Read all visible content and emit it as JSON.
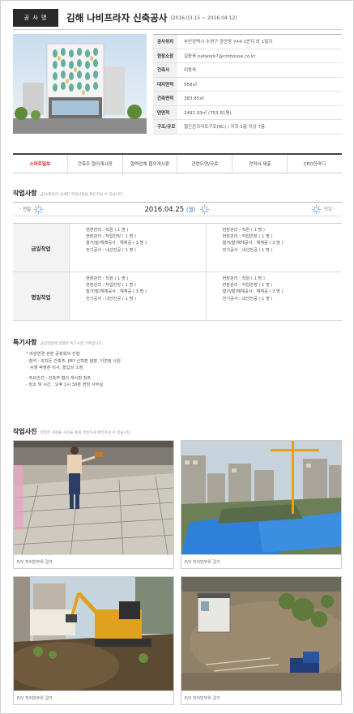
{
  "header": {
    "badge": "공 사 명",
    "title": "김해 나비프라자 신축공사",
    "dates": "(2016.03.15 ~ 2016.04.12)"
  },
  "info": [
    {
      "k": "공사위치",
      "v": "부산광역시 수영구 광안동 744-1번지 외 1필지"
    },
    {
      "k": "현장소장",
      "v": "김동욱 network7@cmhouse.co.kr"
    },
    {
      "k": "건축사",
      "v": "이동욱"
    },
    {
      "k": "대지면적",
      "v": "558㎡"
    },
    {
      "k": "건축면적",
      "v": "383.85㎡"
    },
    {
      "k": "연면적",
      "v": "2491.93㎡ (753.81평)"
    },
    {
      "k": "구조/규모",
      "v": "철근콘크리트구조(RC) / 지하 1층 지상 7층"
    }
  ],
  "tabs": [
    "스마트일보",
    "건축주 협의게시판",
    "협력업체 협의게시판",
    "관련도면/자료",
    "견적서 제출",
    "CEO한마디"
  ],
  "work": {
    "title": "작업사항",
    "desc": "금일/명일의 상세한 작업사항을 확인하실 수 있습니다.",
    "prev": "전일",
    "next": "명일",
    "date": "2016.04.25",
    "weekday": "(월)",
    "rows": [
      {
        "label": "금일작업",
        "cells": [
          [
            "현장관리 : 직원 ( 1 명 )",
            "현장관리 : 작업반장 ( 1 명 )",
            "철거/발/해체공사 : 해체공 ( 3 명 )",
            "전기공사 : 내선전공 ( 1 명 )"
          ],
          [
            "현장관리 : 직원 ( 1 명 )",
            "현장관리 : 작업반장 ( 1 명 )",
            "철거/발/해체공사 : 해체공 ( 3 명 )",
            "전기공사 : 내선전공 ( 1 명 )"
          ]
        ]
      },
      {
        "label": "명일작업",
        "cells": [
          [
            "현장관리 : 직원 ( 1 명 )",
            "현장관리 : 작업반장 ( 1 명 )",
            "철거/발/해체공사 : 해체공 ( 3 명 )",
            "전기공사 : 내선전공 ( 1 명 )"
          ],
          [
            "현장관리 : 직원 ( 1 명 )",
            "현장관리 : 작업반장 ( 1 명 )",
            "철거/발/해체공사 : 해체공 ( 3 명 )",
            "전기공사 : 내선전공 ( 1 명 )"
          ]
        ]
      }
    ]
  },
  "notes": {
    "title": "특기사항",
    "desc": "금일작업에 발생한 특기사항 기록입니다.",
    "lines": [
      "* 마감변경 관련 공정회의 진행",
      "- 참석 : 회치돈 건축주, JMY 신혁훈 팀장, 이연정 사원",
      "  씨엠 박정훈 이사, 황갑상 소장",
      "",
      "- 주요안건 : 건축주 협의 게시판 참조",
      "- 장소 및 시간 : 오후 1시 30분 현장 사무실"
    ]
  },
  "photos": {
    "title": "작업사진",
    "desc": "작업한 내용을 사진을 통해 생생하게 확인하실 수 있습니다.",
    "items": [
      {
        "caption": "E/V 저어반부위 걸거",
        "scene": "deck"
      },
      {
        "caption": "E/V 저어반부위 걸거",
        "scene": "site"
      },
      {
        "caption": "E/V 저어반부위 걸거",
        "scene": "excavator"
      },
      {
        "caption": "E/V 저어반부위 걸거",
        "scene": "dirt"
      }
    ]
  },
  "colors": {
    "accent": "#e02020",
    "badge_bg": "#2a2a2a",
    "weekday": "#3377cc",
    "tarp_blue": "#2f80d8"
  }
}
